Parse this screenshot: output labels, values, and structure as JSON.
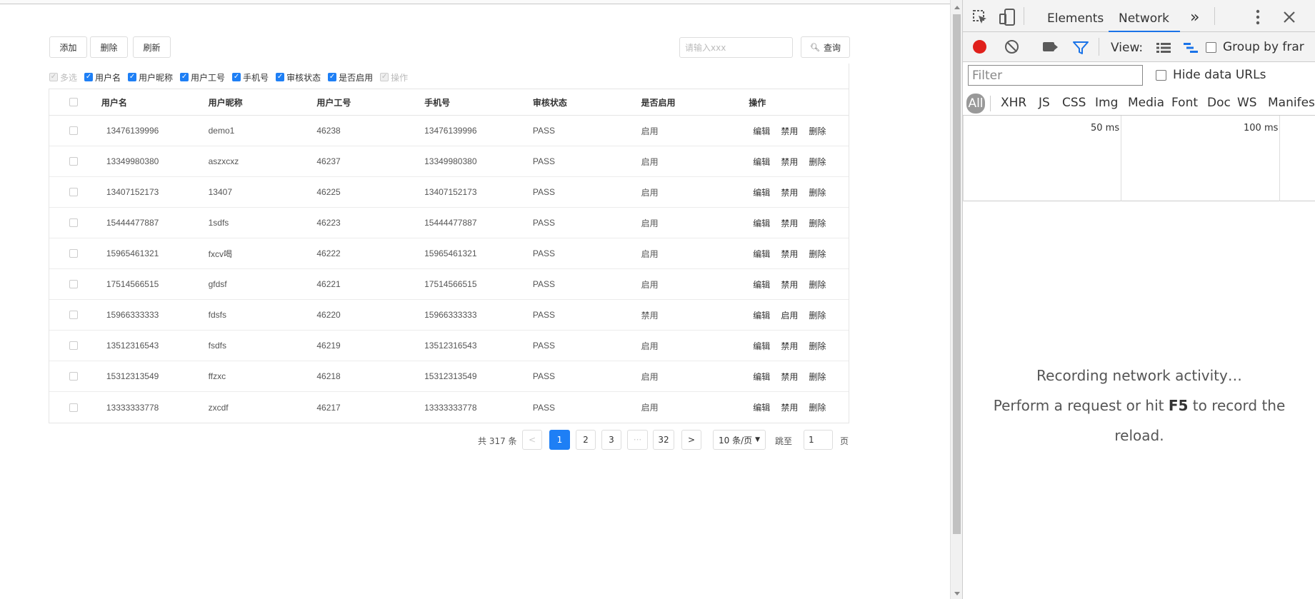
{
  "toolbar": {
    "add_label": "添加",
    "delete_label": "删除",
    "refresh_label": "刷新",
    "search_placeholder": "请输入xxx",
    "search_label": "查询"
  },
  "column_toggles": [
    {
      "label": "多选",
      "checked": true,
      "disabled": true
    },
    {
      "label": "用户名",
      "checked": true,
      "disabled": false
    },
    {
      "label": "用户昵称",
      "checked": true,
      "disabled": false
    },
    {
      "label": "用户工号",
      "checked": true,
      "disabled": false
    },
    {
      "label": "手机号",
      "checked": true,
      "disabled": false
    },
    {
      "label": "审核状态",
      "checked": true,
      "disabled": false
    },
    {
      "label": "是否启用",
      "checked": true,
      "disabled": false
    },
    {
      "label": "操作",
      "checked": true,
      "disabled": true
    }
  ],
  "table": {
    "headers": [
      "用户名",
      "用户昵称",
      "用户工号",
      "手机号",
      "审核状态",
      "是否启用",
      "操作"
    ],
    "rows": [
      {
        "username": "13476139996",
        "nickname": "demo1",
        "empno": "46238",
        "phone": "13476139996",
        "status": "PASS",
        "enabled": "启用",
        "actions": [
          "编辑",
          "禁用",
          "删除"
        ]
      },
      {
        "username": "13349980380",
        "nickname": "aszxcxz",
        "empno": "46237",
        "phone": "13349980380",
        "status": "PASS",
        "enabled": "启用",
        "actions": [
          "编辑",
          "禁用",
          "删除"
        ]
      },
      {
        "username": "13407152173",
        "nickname": "13407",
        "empno": "46225",
        "phone": "13407152173",
        "status": "PASS",
        "enabled": "启用",
        "actions": [
          "编辑",
          "禁用",
          "删除"
        ]
      },
      {
        "username": "15444477887",
        "nickname": "1sdfs",
        "empno": "46223",
        "phone": "15444477887",
        "status": "PASS",
        "enabled": "启用",
        "actions": [
          "编辑",
          "禁用",
          "删除"
        ]
      },
      {
        "username": "15965461321",
        "nickname": "fxcv喝",
        "empno": "46222",
        "phone": "15965461321",
        "status": "PASS",
        "enabled": "启用",
        "actions": [
          "编辑",
          "禁用",
          "删除"
        ]
      },
      {
        "username": "17514566515",
        "nickname": "gfdsf",
        "empno": "46221",
        "phone": "17514566515",
        "status": "PASS",
        "enabled": "启用",
        "actions": [
          "编辑",
          "禁用",
          "删除"
        ]
      },
      {
        "username": "15966333333",
        "nickname": "fdsfs",
        "empno": "46220",
        "phone": "15966333333",
        "status": "PASS",
        "enabled": "禁用",
        "actions": [
          "编辑",
          "启用",
          "删除"
        ]
      },
      {
        "username": "13512316543",
        "nickname": "fsdfs",
        "empno": "46219",
        "phone": "13512316543",
        "status": "PASS",
        "enabled": "启用",
        "actions": [
          "编辑",
          "禁用",
          "删除"
        ]
      },
      {
        "username": "15312313549",
        "nickname": "ffzxc",
        "empno": "46218",
        "phone": "15312313549",
        "status": "PASS",
        "enabled": "启用",
        "actions": [
          "编辑",
          "禁用",
          "删除"
        ]
      },
      {
        "username": "13333333778",
        "nickname": "zxcdf",
        "empno": "46217",
        "phone": "13333333778",
        "status": "PASS",
        "enabled": "启用",
        "actions": [
          "编辑",
          "禁用",
          "删除"
        ]
      }
    ]
  },
  "pagination": {
    "total_text": "共 317 条",
    "prev": "<",
    "pages": [
      "1",
      "2",
      "3",
      "···",
      "32"
    ],
    "next": ">",
    "page_size": "10 条/页",
    "jump_label": "跳至",
    "jump_value": "1",
    "page_suffix": "页"
  },
  "devtools": {
    "tabs": [
      "Elements",
      "Network"
    ],
    "more": "»",
    "view_label": "View:",
    "group_label": "Group by frar",
    "filter_placeholder": "Filter",
    "hide_data_urls": "Hide data URLs",
    "types": [
      "All",
      "XHR",
      "JS",
      "CSS",
      "Img",
      "Media",
      "Font",
      "Doc",
      "WS",
      "Manifes"
    ],
    "timeline_labels": [
      "50 ms",
      "100 ms"
    ],
    "empty_line1": "Recording network activity…",
    "empty_line2_pre": "Perform a request or hit ",
    "empty_key": "F5",
    "empty_line2_post": " to record the",
    "empty_line3": "reload."
  },
  "colors": {
    "accent": "#1e7ff5",
    "record": "#e0201b",
    "devtools_link": "#1a73e8"
  }
}
